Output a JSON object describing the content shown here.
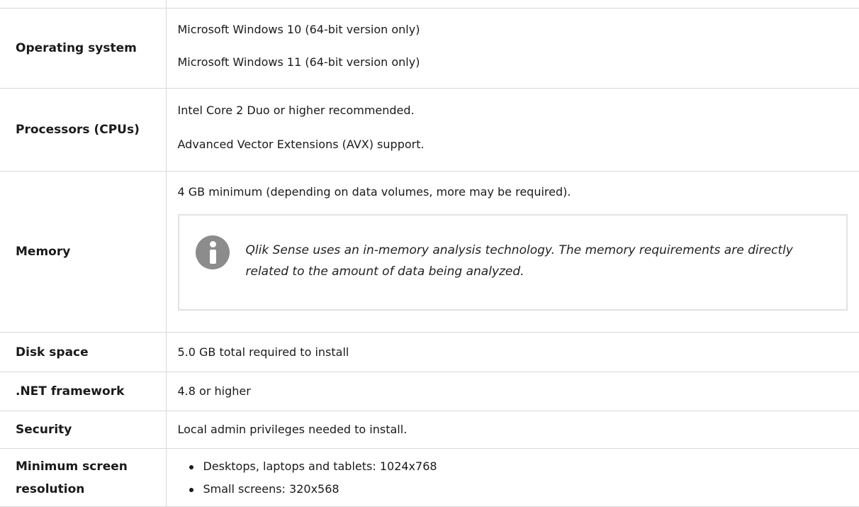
{
  "table": {
    "rows": [
      {
        "label": "Operating system",
        "values": [
          "Microsoft Windows 10 (64-bit version only)",
          "Microsoft Windows 11 (64-bit version only)"
        ]
      },
      {
        "label": "Processors (CPUs)",
        "values": [
          "Intel Core 2 Duo or higher recommended.",
          "Advanced Vector Extensions (AVX) support."
        ]
      },
      {
        "label": "Memory",
        "values": [
          "4 GB minimum (depending on data volumes, more may be required)."
        ],
        "note": {
          "icon": "info-icon",
          "text": "Qlik Sense uses an in-memory analysis technology. The memory requirements are directly related to the amount of data being analyzed."
        }
      },
      {
        "label": "Disk space",
        "values": [
          "5.0 GB total required to install"
        ]
      },
      {
        "label": ".NET framework",
        "values": [
          "4.8 or higher"
        ]
      },
      {
        "label": "Security",
        "values": [
          "Local admin privileges needed to install."
        ]
      },
      {
        "label": "Minimum screen resolution",
        "bullets": [
          "Desktops, laptops and tablets: 1024x768",
          "Small screens: 320x568"
        ]
      }
    ]
  },
  "colors": {
    "border": "#d9d9d9",
    "note_border": "#e2e2e2",
    "icon": "#8c8c8c",
    "text": "#1a1a1a"
  }
}
